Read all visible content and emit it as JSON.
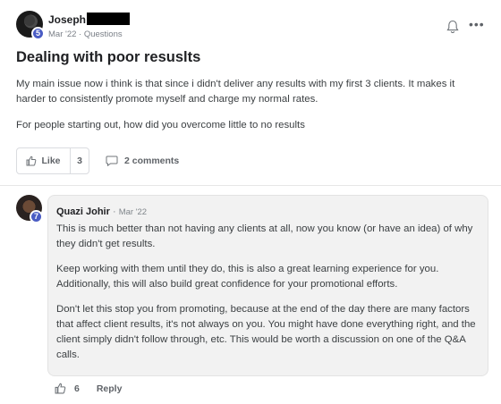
{
  "post": {
    "author": "Joseph",
    "author_level": "5",
    "meta": "Mar '22 · Questions",
    "title": "Dealing with poor resuslts",
    "body": [
      "My main issue now i think is that since i didn't deliver any results with my first 3 clients. It makes it harder to consistently promote myself and charge my normal rates.",
      "For people starting out, how did you overcome little to no results"
    ],
    "like_label": "Like",
    "like_count": "3",
    "comments_label": "2 comments"
  },
  "comment": {
    "author": "Quazi Johir",
    "separator": " · ",
    "time": "Mar '22",
    "author_level": "7",
    "body": [
      "This is much better than not having any clients at all, now you know (or have an idea) of why they didn't get results.",
      "Keep working with them until they do, this is also a great learning experience for you. Additionally, this will also build great confidence for your promotional efforts.",
      "Don't let this stop you from promoting, because at the end of the day there are many factors that affect client results, it's not always on you. You might have done everything right, and the client simply didn't follow through, etc. This would be worth a discussion on one of the Q&A calls."
    ],
    "like_count": "6",
    "reply_label": "Reply"
  },
  "icons": {
    "bell": "bell-icon",
    "more": "more-options-icon",
    "thumbs_up": "thumbs-up-icon",
    "comment": "comment-bubble-icon"
  },
  "colors": {
    "level_badge": "#4a5cc4",
    "comment_bg": "#f2f2f2"
  }
}
